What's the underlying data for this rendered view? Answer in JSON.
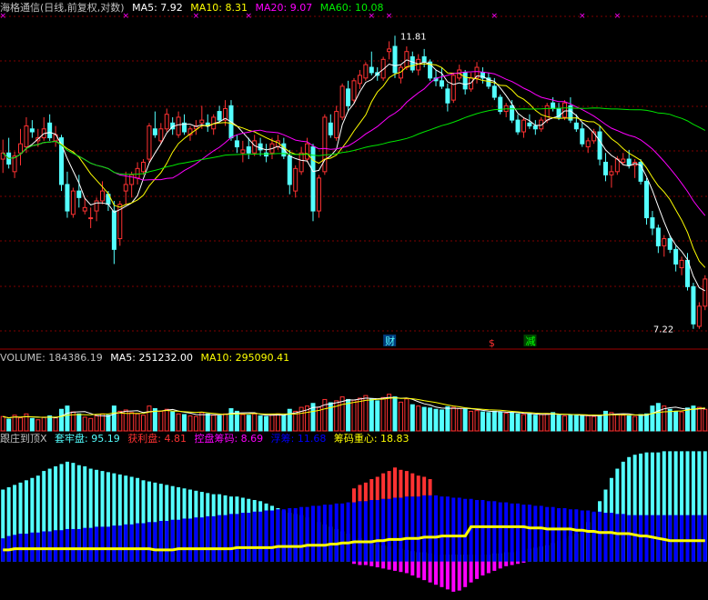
{
  "header_main": {
    "title": "海格通信(日线,前复权,对数)",
    "ma5": "MA5: 7.92",
    "ma10": "MA10: 8.31",
    "ma20": "MA20: 9.07",
    "ma60": "MA60: 10.08"
  },
  "header_volume": {
    "volume": "VOLUME: 184386.19",
    "ma5": "MA5: 251232.00",
    "ma10": "MA10: 295090.41"
  },
  "header_indicator": {
    "name": "跟庄到顶X",
    "trapped": "套牢盘: 95.19",
    "profit": "获利盘: 4.81",
    "control": "控盘筹码: 8.69",
    "float": "浮筹: 11.68",
    "center": "筹码重心: 18.83"
  },
  "colors": {
    "up": "#ff3232",
    "down": "#54ffff",
    "ma5": "#ffffff",
    "ma10": "#ffff00",
    "ma20": "#ff00ff",
    "ma60": "#00e600",
    "trapped": "#54ffff",
    "profit": "#ff3232",
    "control": "#ff00ff",
    "float": "#0000ff",
    "center": "#ffff00"
  },
  "markers": {
    "high": "11.81",
    "low": "7.22",
    "cai": "财",
    "s": "$",
    "jian": "减"
  },
  "chart_data": {
    "type": "candlestick",
    "ylim_price": [
      7.0,
      12.2
    ],
    "ylim_volume": [
      0,
      1000
    ],
    "ylim_indicator": [
      -30,
      100
    ],
    "ohlc": [
      [
        9.6,
        9.92,
        9.38,
        9.7
      ],
      [
        9.7,
        9.95,
        9.45,
        9.52
      ],
      [
        9.4,
        9.72,
        9.3,
        9.65
      ],
      [
        9.7,
        10.1,
        9.5,
        9.85
      ],
      [
        9.8,
        10.3,
        9.7,
        10.15
      ],
      [
        10.1,
        10.25,
        9.95,
        10.05
      ],
      [
        9.9,
        10.1,
        9.8,
        9.95
      ],
      [
        9.95,
        10.3,
        9.9,
        10.1
      ],
      [
        10.2,
        10.35,
        9.9,
        9.95
      ],
      [
        9.9,
        10.15,
        9.8,
        10.0
      ],
      [
        9.95,
        10.0,
        9.1,
        9.2
      ],
      [
        9.2,
        9.4,
        8.7,
        8.8
      ],
      [
        8.75,
        9.15,
        8.7,
        9.1
      ],
      [
        9.1,
        9.35,
        8.85,
        9.0
      ],
      [
        8.8,
        9.0,
        8.75,
        8.85
      ],
      [
        8.7,
        8.85,
        8.55,
        8.7
      ],
      [
        8.8,
        9.0,
        8.65,
        8.95
      ],
      [
        8.95,
        9.25,
        8.9,
        9.1
      ],
      [
        9.05,
        9.1,
        8.8,
        8.9
      ],
      [
        8.8,
        8.95,
        8.05,
        8.25
      ],
      [
        8.4,
        8.95,
        8.3,
        8.9
      ],
      [
        9.1,
        9.4,
        8.9,
        9.2
      ],
      [
        9.2,
        9.4,
        9.0,
        9.35
      ],
      [
        9.3,
        9.55,
        9.2,
        9.45
      ],
      [
        9.4,
        9.6,
        9.35,
        9.55
      ],
      [
        9.6,
        10.2,
        9.55,
        10.15
      ],
      [
        10.1,
        10.4,
        9.95,
        10.0
      ],
      [
        9.9,
        10.2,
        9.85,
        10.1
      ],
      [
        10.1,
        10.45,
        10.05,
        10.35
      ],
      [
        10.2,
        10.3,
        10.0,
        10.1
      ],
      [
        10.0,
        10.4,
        9.95,
        10.3
      ],
      [
        10.2,
        10.35,
        10.0,
        10.05
      ],
      [
        10.0,
        10.15,
        9.9,
        10.1
      ],
      [
        10.1,
        10.25,
        10.0,
        10.15
      ],
      [
        10.2,
        10.5,
        10.1,
        10.25
      ],
      [
        10.2,
        10.35,
        10.05,
        10.15
      ],
      [
        10.1,
        10.35,
        10.0,
        10.3
      ],
      [
        10.4,
        10.5,
        10.2,
        10.25
      ],
      [
        10.25,
        10.6,
        10.15,
        10.45
      ],
      [
        10.5,
        10.6,
        9.9,
        9.95
      ],
      [
        9.9,
        10.0,
        9.7,
        9.8
      ],
      [
        9.7,
        9.9,
        9.55,
        9.75
      ],
      [
        9.8,
        9.95,
        9.6,
        9.7
      ],
      [
        9.7,
        10.0,
        9.65,
        9.9
      ],
      [
        9.85,
        9.95,
        9.65,
        9.75
      ],
      [
        9.7,
        9.85,
        9.55,
        9.65
      ],
      [
        9.7,
        9.95,
        9.6,
        9.85
      ],
      [
        9.8,
        10.0,
        9.75,
        9.9
      ],
      [
        9.85,
        9.95,
        9.6,
        9.65
      ],
      [
        9.65,
        9.75,
        9.05,
        9.2
      ],
      [
        9.1,
        9.5,
        9.0,
        9.45
      ],
      [
        9.4,
        9.8,
        9.35,
        9.7
      ],
      [
        9.6,
        9.95,
        9.55,
        9.85
      ],
      [
        9.8,
        9.85,
        8.65,
        8.8
      ],
      [
        8.8,
        9.35,
        8.7,
        9.3
      ],
      [
        9.4,
        10.35,
        9.35,
        10.3
      ],
      [
        10.2,
        10.35,
        9.95,
        10.0
      ],
      [
        9.95,
        10.5,
        9.9,
        10.4
      ],
      [
        10.3,
        10.9,
        10.25,
        10.85
      ],
      [
        10.8,
        10.95,
        10.4,
        10.5
      ],
      [
        10.6,
        11.0,
        10.55,
        10.95
      ],
      [
        10.9,
        11.15,
        10.8,
        11.05
      ],
      [
        11.0,
        11.3,
        10.95,
        11.25
      ],
      [
        11.2,
        11.5,
        11.05,
        11.1
      ],
      [
        11.1,
        11.2,
        10.95,
        11.05
      ],
      [
        11.0,
        11.4,
        10.95,
        11.35
      ],
      [
        11.5,
        11.7,
        11.35,
        11.55
      ],
      [
        11.6,
        11.81,
        11.0,
        11.1
      ],
      [
        11.0,
        11.25,
        10.9,
        11.2
      ],
      [
        11.2,
        11.6,
        11.15,
        11.5
      ],
      [
        11.4,
        11.5,
        11.1,
        11.15
      ],
      [
        11.15,
        11.45,
        11.05,
        11.35
      ],
      [
        11.4,
        11.55,
        11.2,
        11.3
      ],
      [
        11.3,
        11.35,
        10.95,
        11.0
      ],
      [
        11.0,
        11.15,
        10.85,
        10.95
      ],
      [
        10.95,
        11.2,
        10.8,
        10.85
      ],
      [
        10.8,
        10.9,
        10.4,
        10.55
      ],
      [
        10.6,
        11.1,
        10.55,
        11.05
      ],
      [
        11.0,
        11.25,
        10.95,
        11.15
      ],
      [
        11.1,
        11.15,
        10.7,
        10.8
      ],
      [
        10.8,
        11.1,
        10.75,
        11.0
      ],
      [
        11.0,
        11.3,
        10.9,
        11.2
      ],
      [
        11.1,
        11.2,
        10.9,
        11.0
      ],
      [
        11.0,
        11.1,
        10.8,
        10.85
      ],
      [
        10.85,
        11.0,
        10.6,
        10.65
      ],
      [
        10.65,
        10.7,
        10.35,
        10.4
      ],
      [
        10.4,
        10.55,
        10.3,
        10.5
      ],
      [
        10.5,
        10.6,
        10.2,
        10.25
      ],
      [
        10.25,
        10.35,
        10.0,
        10.05
      ],
      [
        10.05,
        10.3,
        9.95,
        10.25
      ],
      [
        10.2,
        10.35,
        10.1,
        10.15
      ],
      [
        10.15,
        10.25,
        10.0,
        10.1
      ],
      [
        10.1,
        10.3,
        10.05,
        10.25
      ],
      [
        10.25,
        10.55,
        10.2,
        10.5
      ],
      [
        10.55,
        10.65,
        10.4,
        10.45
      ],
      [
        10.45,
        10.55,
        10.25,
        10.3
      ],
      [
        10.3,
        10.6,
        10.25,
        10.55
      ],
      [
        10.5,
        10.65,
        10.2,
        10.25
      ],
      [
        10.2,
        10.35,
        10.05,
        10.1
      ],
      [
        10.1,
        10.2,
        9.8,
        9.85
      ],
      [
        9.8,
        9.95,
        9.7,
        9.9
      ],
      [
        9.9,
        10.1,
        9.85,
        10.05
      ],
      [
        10.05,
        10.15,
        9.5,
        9.6
      ],
      [
        9.55,
        9.7,
        9.25,
        9.35
      ],
      [
        9.35,
        9.5,
        9.15,
        9.4
      ],
      [
        9.4,
        9.65,
        9.35,
        9.6
      ],
      [
        9.55,
        9.7,
        9.5,
        9.6
      ],
      [
        9.6,
        9.75,
        9.45,
        9.5
      ],
      [
        9.5,
        9.6,
        9.3,
        9.55
      ],
      [
        9.55,
        9.6,
        9.2,
        9.25
      ],
      [
        9.25,
        9.3,
        8.6,
        8.7
      ],
      [
        8.7,
        8.8,
        8.45,
        8.55
      ],
      [
        8.55,
        8.6,
        8.2,
        8.3
      ],
      [
        8.3,
        8.45,
        8.15,
        8.4
      ],
      [
        8.4,
        8.45,
        8.2,
        8.25
      ],
      [
        8.25,
        8.3,
        7.95,
        8.05
      ],
      [
        8.0,
        8.15,
        7.9,
        8.1
      ],
      [
        8.1,
        8.2,
        7.7,
        7.75
      ],
      [
        7.75,
        7.8,
        7.22,
        7.28
      ],
      [
        7.25,
        7.55,
        7.22,
        7.5
      ],
      [
        7.5,
        7.9,
        7.45,
        7.85
      ]
    ],
    "volume": [
      220,
      180,
      240,
      200,
      260,
      190,
      170,
      210,
      230,
      200,
      330,
      380,
      290,
      260,
      210,
      190,
      230,
      260,
      240,
      380,
      300,
      320,
      280,
      260,
      240,
      380,
      340,
      300,
      330,
      290,
      260,
      250,
      230,
      220,
      280,
      260,
      240,
      230,
      260,
      340,
      300,
      250,
      240,
      260,
      230,
      220,
      250,
      260,
      240,
      330,
      300,
      360,
      380,
      420,
      360,
      480,
      430,
      460,
      520,
      480,
      470,
      500,
      540,
      490,
      460,
      510,
      560,
      520,
      440,
      490,
      400,
      380,
      360,
      350,
      330,
      320,
      370,
      360,
      340,
      330,
      300,
      310,
      290,
      280,
      300,
      290,
      270,
      280,
      260,
      250,
      260,
      240,
      250,
      260,
      280,
      240,
      230,
      250,
      240,
      230,
      230,
      220,
      240,
      300,
      280,
      250,
      240,
      230,
      220,
      250,
      260,
      380,
      420,
      380,
      330,
      300,
      290,
      350,
      380,
      360,
      330
    ],
    "trapped": [
      62,
      64,
      66,
      68,
      70,
      72,
      74,
      78,
      80,
      82,
      84,
      86,
      85,
      83,
      82,
      80,
      79,
      78,
      77,
      76,
      75,
      74,
      73,
      72,
      70,
      69,
      68,
      67,
      66,
      65,
      64,
      63,
      62,
      61,
      60,
      59,
      58,
      58,
      57,
      56,
      56,
      55,
      54,
      53,
      52,
      50,
      48,
      46,
      44,
      42,
      41,
      40,
      38,
      36,
      34,
      32,
      30,
      28,
      26,
      24,
      22,
      20,
      18,
      16,
      15,
      14,
      13,
      12,
      11,
      10,
      9,
      8,
      8,
      7,
      6,
      6,
      6,
      6,
      6,
      6,
      6,
      6,
      6,
      6,
      7,
      7,
      8,
      8,
      9,
      10,
      11,
      12,
      13,
      14,
      16,
      18,
      20,
      22,
      24,
      28,
      34,
      42,
      52,
      62,
      72,
      80,
      86,
      90,
      92,
      93,
      94,
      94,
      94,
      95,
      95,
      95,
      95,
      95,
      95,
      95,
      95
    ],
    "control": [
      20,
      22,
      23,
      24,
      24,
      25,
      25,
      26,
      26,
      27,
      27,
      28,
      28,
      28,
      29,
      29,
      30,
      30,
      30,
      31,
      31,
      32,
      32,
      33,
      33,
      34,
      34,
      35,
      35,
      36,
      36,
      37,
      37,
      38,
      38,
      39,
      39,
      40,
      40,
      41,
      41,
      42,
      42,
      43,
      43,
      44,
      44,
      45,
      45,
      46,
      46,
      47,
      47,
      48,
      48,
      49,
      49,
      50,
      50,
      51,
      51,
      52,
      52,
      53,
      53,
      54,
      54,
      55,
      55,
      56,
      56,
      56,
      57,
      57,
      57,
      56,
      56,
      55,
      55,
      54,
      54,
      53,
      53,
      52,
      52,
      51,
      51,
      50,
      50,
      49,
      49,
      48,
      48,
      47,
      47,
      46,
      46,
      45,
      45,
      44,
      44,
      43,
      43,
      42,
      42,
      41,
      41,
      40,
      40,
      40,
      40,
      40,
      40,
      40,
      40,
      40,
      40,
      40,
      40,
      40,
      40
    ],
    "float_neg": [
      0,
      0,
      0,
      0,
      0,
      0,
      0,
      0,
      0,
      0,
      0,
      0,
      0,
      0,
      0,
      0,
      0,
      0,
      0,
      0,
      0,
      0,
      0,
      0,
      0,
      0,
      0,
      0,
      0,
      0,
      0,
      0,
      0,
      0,
      0,
      0,
      0,
      0,
      0,
      0,
      0,
      0,
      0,
      0,
      0,
      0,
      0,
      0,
      0,
      0,
      0,
      0,
      0,
      0,
      0,
      0,
      0,
      0,
      0,
      0,
      0,
      0,
      0,
      0,
      0,
      0,
      0,
      0,
      0,
      0,
      0,
      0,
      0,
      0,
      0,
      0,
      0,
      0,
      0,
      0,
      0,
      0,
      0,
      0,
      0,
      0,
      0,
      0,
      0,
      0,
      0,
      0,
      0,
      0,
      0,
      0,
      0,
      0,
      0,
      0,
      0,
      0,
      0,
      0,
      0,
      0,
      0,
      0,
      0,
      0,
      0,
      0,
      0,
      0,
      0,
      0,
      0,
      0,
      0,
      0,
      0
    ],
    "magenta_neg": [
      0,
      0,
      0,
      0,
      0,
      0,
      0,
      0,
      0,
      0,
      0,
      0,
      0,
      0,
      0,
      0,
      0,
      0,
      0,
      0,
      0,
      0,
      0,
      0,
      0,
      0,
      0,
      0,
      0,
      0,
      0,
      0,
      0,
      0,
      0,
      0,
      0,
      0,
      0,
      0,
      0,
      0,
      0,
      0,
      0,
      0,
      0,
      0,
      0,
      0,
      0,
      0,
      0,
      0,
      0,
      0,
      0,
      0,
      0,
      0,
      2,
      3,
      3,
      4,
      5,
      6,
      7,
      8,
      9,
      10,
      12,
      14,
      16,
      18,
      20,
      22,
      24,
      26,
      25,
      22,
      18,
      15,
      12,
      10,
      8,
      6,
      4,
      3,
      2,
      1,
      0,
      0,
      0,
      0,
      0,
      0,
      0,
      0,
      0,
      0,
      0,
      0,
      0,
      0,
      0,
      0,
      0,
      0,
      0,
      0,
      0,
      0,
      0,
      0,
      0,
      0,
      0,
      0,
      0,
      0,
      0
    ],
    "center": [
      10,
      10,
      11,
      11,
      11,
      11,
      11,
      11,
      11,
      11,
      11,
      11,
      11,
      11,
      11,
      11,
      11,
      11,
      11,
      11,
      11,
      11,
      11,
      11,
      11,
      11,
      10,
      10,
      10,
      10,
      11,
      11,
      11,
      11,
      11,
      11,
      11,
      11,
      11,
      11,
      12,
      12,
      12,
      12,
      12,
      12,
      12,
      13,
      13,
      13,
      13,
      13,
      14,
      14,
      14,
      14,
      15,
      15,
      16,
      16,
      17,
      17,
      17,
      17,
      18,
      18,
      19,
      19,
      19,
      20,
      20,
      20,
      21,
      21,
      21,
      22,
      22,
      22,
      22,
      22,
      30,
      30,
      30,
      30,
      30,
      30,
      30,
      30,
      30,
      30,
      29,
      29,
      29,
      28,
      28,
      28,
      28,
      28,
      27,
      27,
      26,
      26,
      25,
      25,
      25,
      24,
      24,
      24,
      23,
      22,
      22,
      21,
      20,
      19,
      18,
      18,
      18,
      18,
      18,
      18,
      18
    ]
  }
}
